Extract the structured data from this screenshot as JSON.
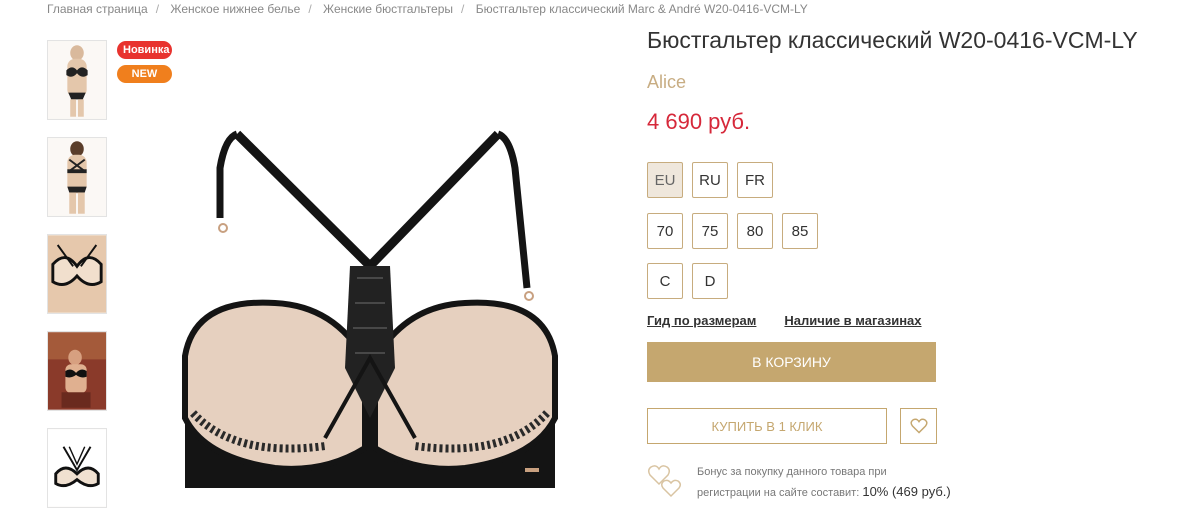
{
  "breadcrumb": [
    "Главная страница",
    "Женское нижнее белье",
    "Женские бюстгальтеры",
    "Бюстгальтер классический Marc & André W20-0416-VCM-LY"
  ],
  "badges": {
    "new_ru": "Новинка",
    "new_en": "NEW"
  },
  "product": {
    "title": "Бюстгальтер классический W20-0416-VCM-LY",
    "brand": "Alice",
    "price": "4 690 руб."
  },
  "sizes": {
    "systems": [
      "EU",
      "RU",
      "FR"
    ],
    "selected_system": "EU",
    "bands": [
      "70",
      "75",
      "80",
      "85"
    ],
    "cups": [
      "C",
      "D"
    ]
  },
  "links": {
    "size_guide": "Гид по размерам",
    "store_availability": "Наличие в магазинах"
  },
  "buttons": {
    "cart": "В КОРЗИНУ",
    "one_click": "КУПИТЬ В 1 КЛИК"
  },
  "bonus": {
    "line1": "Бонус за покупку данного товара при",
    "line2": "регистрации на сайте составит:",
    "value": "10% (469 руб.)"
  },
  "colors": {
    "accent": "#c5a76f",
    "price": "#d6283a",
    "brand": "#c8ad83",
    "badge_ru": "#e8332f",
    "badge_en": "#f07f1d"
  },
  "icons": {
    "favorite": "heart-icon",
    "bonus": "hearts-icon"
  }
}
